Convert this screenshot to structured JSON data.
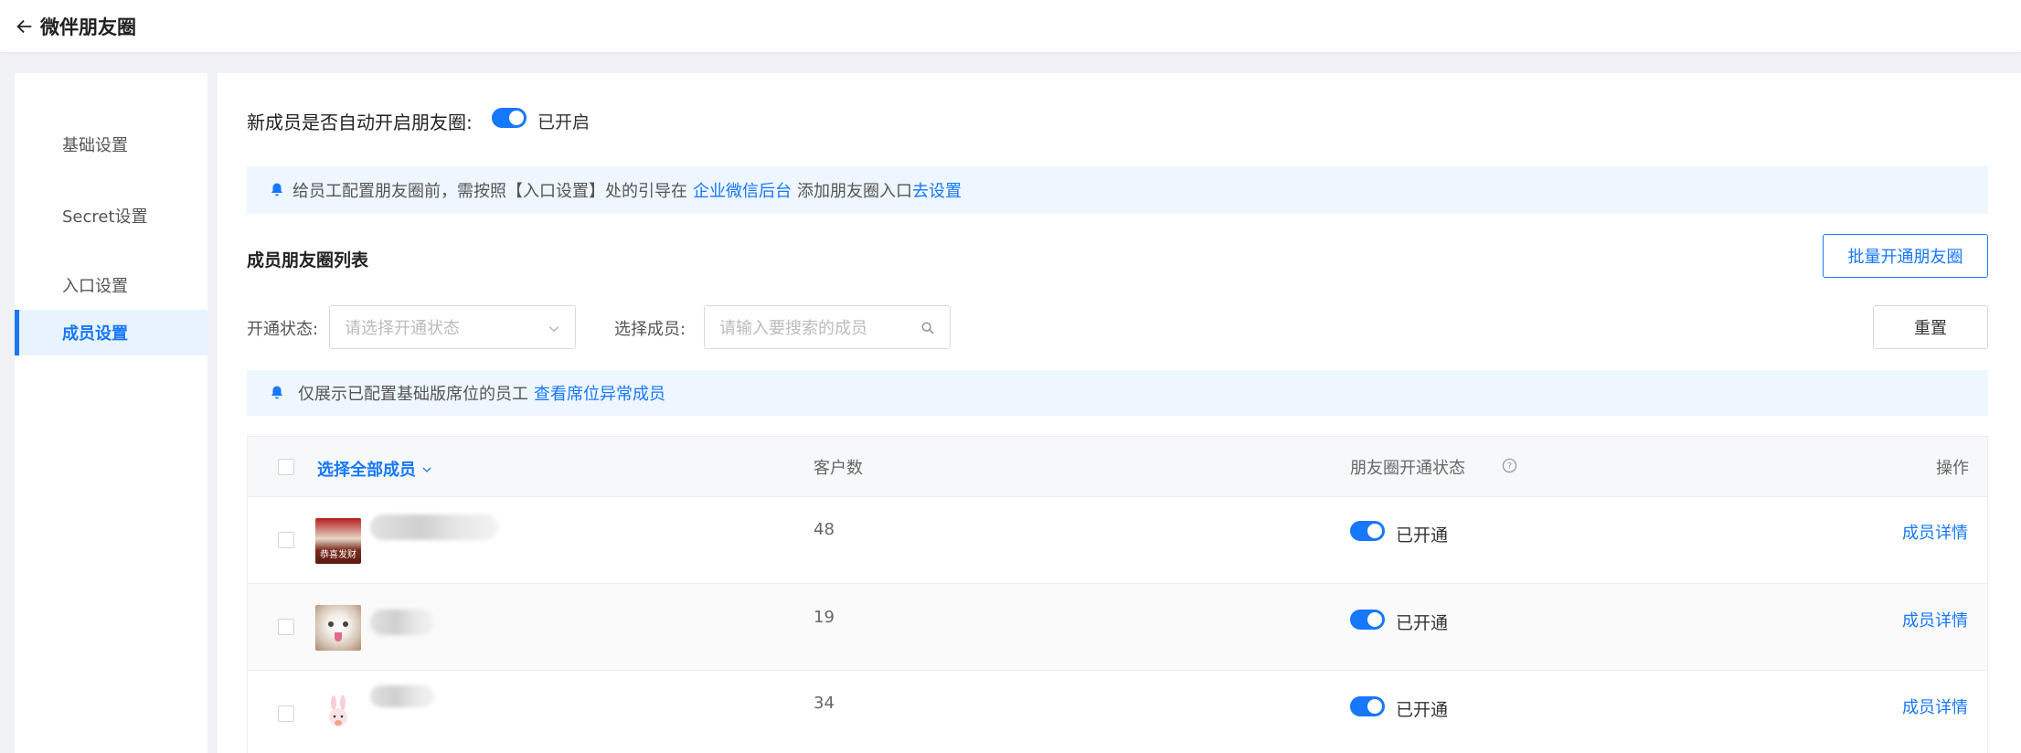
{
  "header": {
    "title": "微伴朋友圈"
  },
  "sidebar": {
    "items": [
      {
        "label": "基础设置"
      },
      {
        "label": "Secret设置"
      },
      {
        "label": "入口设置"
      },
      {
        "label": "成员设置",
        "active": true
      }
    ]
  },
  "auto_enable": {
    "label": "新成员是否自动开启朋友圈:",
    "status": "已开启"
  },
  "notice1": {
    "text": "给员工配置朋友圈前，需按照【入口设置】处的引导在",
    "link1": "企业微信后台",
    "middle": "添加朋友圈入口",
    "link2": "去设置"
  },
  "section": {
    "title": "成员朋友圈列表",
    "batch_button": "批量开通朋友圈"
  },
  "filters": {
    "status_label": "开通状态:",
    "status_placeholder": "请选择开通状态",
    "member_label": "选择成员:",
    "member_placeholder": "请输入要搜索的成员",
    "reset_button": "重置"
  },
  "notice2": {
    "text": "仅展示已配置基础版席位的员工",
    "link": "查看席位异常成员"
  },
  "table": {
    "select_all": "选择全部成员",
    "col_customers": "客户数",
    "col_status": "朋友圈开通状态",
    "col_actions": "操作",
    "rows": [
      {
        "customers": "48",
        "status": "已开通",
        "action": "成员详情",
        "avatar_text": "恭喜发财"
      },
      {
        "customers": "19",
        "status": "已开通",
        "action": "成员详情"
      },
      {
        "customers": "34",
        "status": "已开通",
        "action": "成员详情"
      }
    ]
  },
  "colors": {
    "primary": "#1677ff",
    "notice_bg": "#eef6ff"
  }
}
